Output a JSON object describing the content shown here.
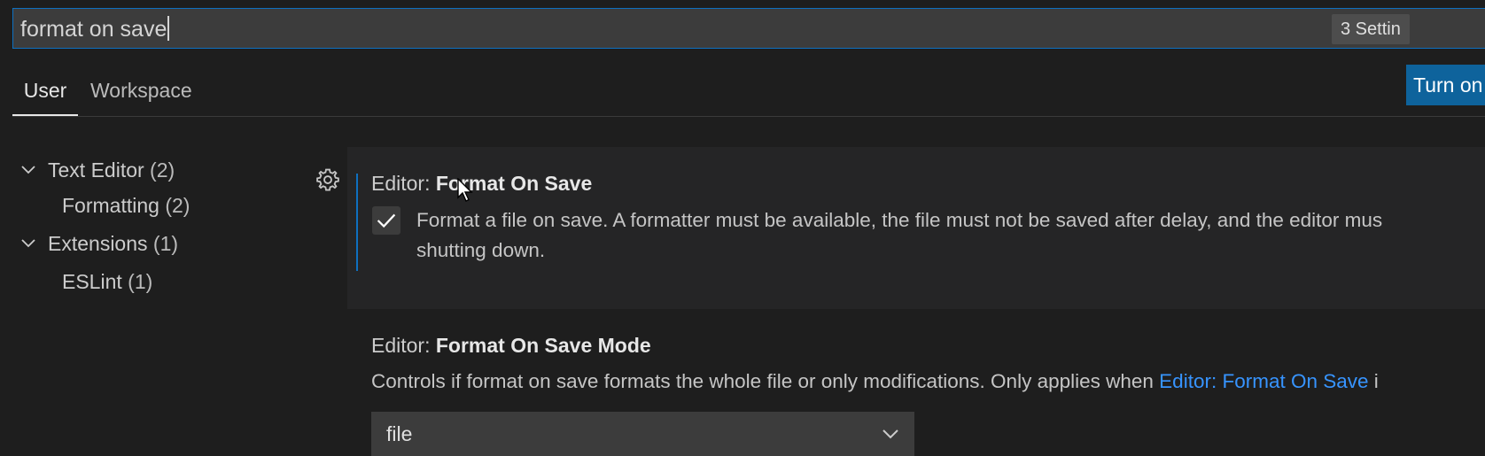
{
  "search": {
    "value": "format on save",
    "result_count": "3 Settin"
  },
  "tabs": [
    {
      "label": "User",
      "active": true
    },
    {
      "label": "Workspace",
      "active": false
    }
  ],
  "sync_button": {
    "label": "Turn on"
  },
  "tree": [
    {
      "label": "Text Editor",
      "count": "(2)",
      "expanded": true,
      "level": 0
    },
    {
      "label": "Formatting",
      "count": "(2)",
      "level": 1
    },
    {
      "label": "Extensions",
      "count": "(1)",
      "expanded": true,
      "level": 0
    },
    {
      "label": "ESLint",
      "count": "(1)",
      "level": 1
    }
  ],
  "settings": [
    {
      "prefix": "Editor: ",
      "name": "Format On Save",
      "checked": true,
      "description_line1": "Format a file on save. A formatter must be available, the file must not be saved after delay, and the editor mus",
      "description_line2": "shutting down."
    },
    {
      "prefix": "Editor: ",
      "name": "Format On Save Mode",
      "description_before_link": "Controls if format on save formats the whole file or only modifications. Only applies when ",
      "description_link": "Editor: Format On Save",
      "description_after_link": " i",
      "selected_value": "file"
    }
  ],
  "colors": {
    "background": "#1e1e1e",
    "accent": "#0e70c0",
    "button": "#0e639c",
    "link": "#3794ff"
  },
  "icons": {
    "gear": "gear-icon",
    "check": "check-icon",
    "chevron_down": "chevron-down-icon"
  }
}
